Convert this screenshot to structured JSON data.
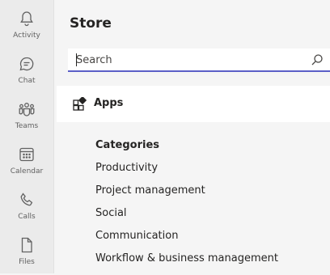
{
  "nav": {
    "items": [
      {
        "label": "Activity",
        "icon": "bell-icon"
      },
      {
        "label": "Chat",
        "icon": "chat-icon"
      },
      {
        "label": "Teams",
        "icon": "teams-icon"
      },
      {
        "label": "Calendar",
        "icon": "calendar-icon"
      },
      {
        "label": "Calls",
        "icon": "phone-icon"
      },
      {
        "label": "Files",
        "icon": "file-icon"
      }
    ]
  },
  "store": {
    "title": "Store",
    "search": {
      "placeholder": "Search",
      "value": ""
    },
    "apps_label": "Apps",
    "categories_heading": "Categories",
    "categories": [
      "Productivity",
      "Project management",
      "Social",
      "Communication",
      "Workflow & business management"
    ]
  },
  "colors": {
    "accent": "#5b5fc7",
    "rail_bg": "#ebebeb",
    "main_bg": "#f5f5f5"
  }
}
